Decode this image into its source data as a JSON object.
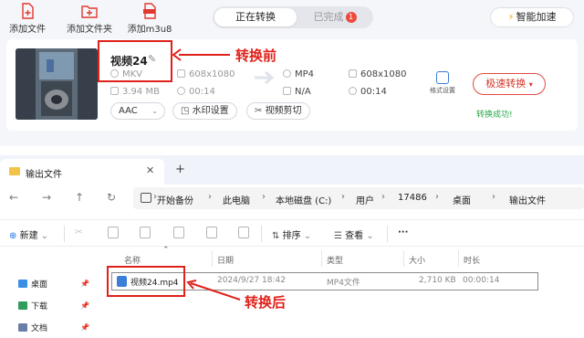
{
  "toolbar": {
    "add_file": "添加文件",
    "add_folder": "添加文件夹",
    "add_m3u8": "添加m3u8"
  },
  "tabs": {
    "converting": "正在转换",
    "completed": "已完成",
    "completed_count": "1"
  },
  "accel_label": "智能加速",
  "task": {
    "file_name": "视频24",
    "source": {
      "format": "MKV",
      "resolution": "608x1080",
      "size": "3.94 MB",
      "duration": "00:14"
    },
    "target": {
      "format": "MP4",
      "resolution": "608x1080",
      "size": "N/A",
      "duration": "00:14"
    },
    "format_settings": "格式设置",
    "convert_button": "极速转换",
    "status": "转换成功!",
    "audio_codec": "AAC",
    "watermark_button": "水印设置",
    "clip_button": "视频剪切"
  },
  "annotations": {
    "before": "转换前",
    "after": "转换后"
  },
  "explorer": {
    "tab_title": "输出文件",
    "breadcrumbs": [
      "开始备份",
      "此电脑",
      "本地磁盘 (C:)",
      "用户",
      "17486",
      "桌面",
      "输出文件"
    ],
    "commands": {
      "new": "新建",
      "sort": "排序",
      "view": "查看",
      "more": "···"
    },
    "columns": {
      "name": "名称",
      "date": "日期",
      "type": "类型",
      "size": "大小",
      "duration": "时长"
    },
    "sidebar": [
      "桌面",
      "下载",
      "文档"
    ],
    "files": [
      {
        "name": "视频24.mp4",
        "date": "2024/9/27 18:42",
        "type": "MP4文件",
        "size": "2,710 KB",
        "duration": "00:00:14"
      }
    ]
  },
  "colors": {
    "accent_red": "#e0201a",
    "success_green": "#2aa84a",
    "folder_yellow": "#f2c347",
    "badge_red": "#ee4b3b"
  }
}
